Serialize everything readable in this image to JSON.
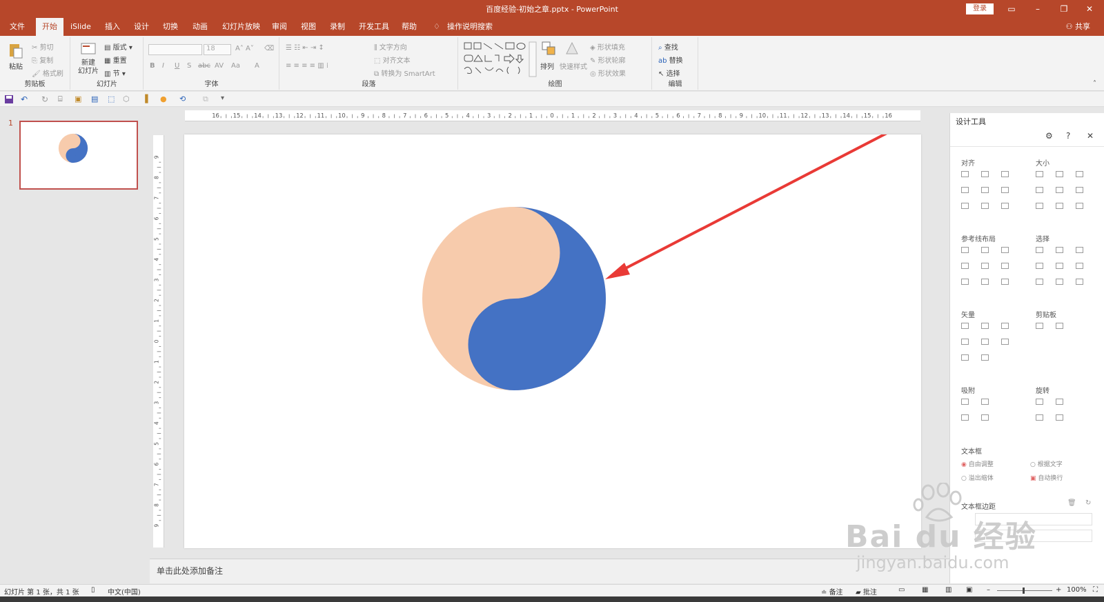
{
  "titlebar": {
    "title": "百度经验-初始之章.pptx  -  PowerPoint",
    "login_label": "登录"
  },
  "tabs": [
    "文件",
    "开始",
    "iSlide",
    "插入",
    "设计",
    "切换",
    "动画",
    "幻灯片放映",
    "审阅",
    "视图",
    "录制",
    "开发工具",
    "帮助"
  ],
  "tell_me": "操作说明搜索",
  "share_label": "共享",
  "ribbon": {
    "clipboard": {
      "paste": "粘贴",
      "cut": "剪切",
      "copy": "复制",
      "format_painter": "格式刷",
      "label": "剪贴板"
    },
    "slides": {
      "new_slide": "新建\n幻灯片",
      "layout": "版式",
      "reset": "重置",
      "section": "节",
      "label": "幻灯片"
    },
    "font": {
      "font_size": "18",
      "label": "字体"
    },
    "paragraph": {
      "text_direction": "文字方向",
      "align_text": "对齐文本",
      "smartart": "转换为 SmartArt",
      "label": "段落"
    },
    "drawing": {
      "arrange": "排列",
      "quick_styles": "快速样式",
      "shape_fill": "形状填充",
      "shape_outline": "形状轮廓",
      "shape_effects": "形状效果",
      "label": "绘图"
    },
    "editing": {
      "find": "查找",
      "replace": "替换",
      "select": "选择",
      "label": "编辑"
    }
  },
  "thumbnails": {
    "slide_number": "1"
  },
  "ruler_h": [
    "16",
    "15",
    "14",
    "13",
    "12",
    "11",
    "10",
    "9",
    "8",
    "7",
    "6",
    "5",
    "4",
    "3",
    "2",
    "1",
    "0",
    "1",
    "2",
    "3",
    "4",
    "5",
    "6",
    "7",
    "8",
    "9",
    "10",
    "11",
    "12",
    "13",
    "14",
    "15",
    "16"
  ],
  "ruler_v": [
    "9",
    "8",
    "7",
    "6",
    "5",
    "4",
    "3",
    "2",
    "1",
    "0",
    "1",
    "2",
    "3",
    "4",
    "5",
    "6",
    "7",
    "8",
    "9"
  ],
  "notes_placeholder": "单击此处添加备注",
  "design_panel": {
    "title": "设计工具",
    "sections": {
      "align": "对齐",
      "size": "大小",
      "guide_layout": "参考线布局",
      "select": "选择",
      "vector": "矢量",
      "clipboard": "剪贴板",
      "snap": "吸附",
      "rotate": "旋转",
      "textbox": "文本框",
      "textbox_margin": "文本框边距"
    },
    "textbox_options": {
      "auto_fit": "自由调整",
      "fit_text": "根据文字",
      "overflow_shrink": "溢出缩体",
      "auto_wrap": "自动换行"
    }
  },
  "statusbar": {
    "slide_info": "幻灯片 第 1 张，共 1 张",
    "language": "中文(中国)",
    "notes": "备注",
    "comments": "批注",
    "zoom": "100%"
  },
  "watermark": {
    "brand": "Bai du 经验",
    "url": "jingyan.baidu.com"
  },
  "colors": {
    "accent": "#b7472a",
    "yin": "#f7cbac",
    "yang": "#4472c4",
    "arrow": "#e93a36"
  }
}
